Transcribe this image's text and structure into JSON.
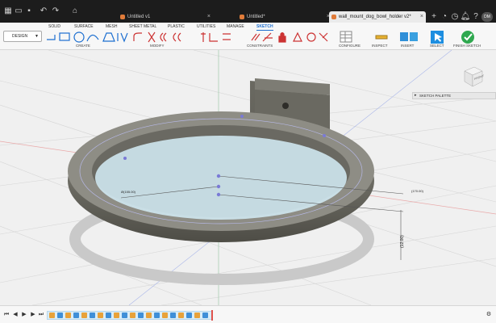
{
  "app_bar": {
    "tabs": [
      {
        "label": "Untitled v1",
        "close": "×"
      },
      {
        "label": "Untitled*",
        "close": "×"
      },
      {
        "label": "wall_mount_dog_bowl_holder v2*",
        "close": "×"
      }
    ],
    "user_initials": "DM"
  },
  "ribbon": {
    "tabs": [
      "SOLID",
      "SURFACE",
      "MESH",
      "SHEET METAL",
      "PLASTIC",
      "UTILITIES",
      "MANAGE",
      "SKETCH"
    ],
    "active_tab": "SKETCH",
    "workspace_label": "DESIGN",
    "groups": {
      "create": "CREATE",
      "modify": "MODIFY",
      "constraints": "CONSTRAINTS",
      "configure": "CONFIGURE",
      "inspect": "INSPECT",
      "insert": "INSERT",
      "select": "SELECT",
      "finish": "FINISH SKETCH"
    }
  },
  "panel": {
    "sketch_palette": "SKETCH PALETTE"
  },
  "viewcube": {
    "face": "FRONT"
  },
  "dimensions": {
    "diameter": "Ø(155.00)",
    "right": "(170.00)",
    "vertical": "(12.00)"
  },
  "colors": {
    "accent": "#1d6fd0",
    "finish_green": "#2fa84f",
    "fusion_orange": "#e07b39",
    "timeline_head": "#e0524c"
  }
}
